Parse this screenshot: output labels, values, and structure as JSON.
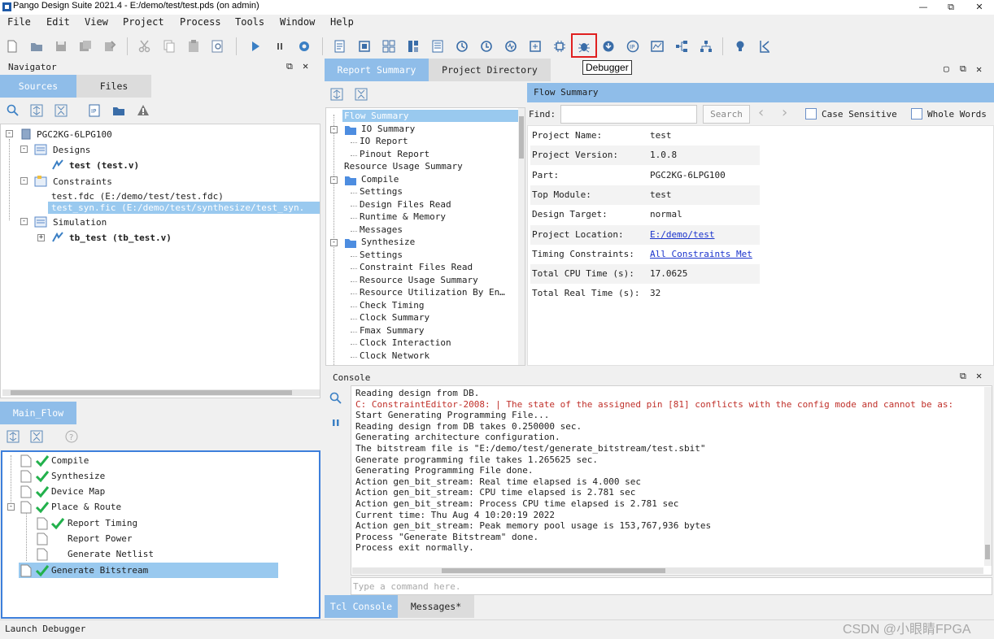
{
  "window": {
    "title": "Pango Design Suite 2021.4 - E:/demo/test/test.pds (on admin)",
    "controls": [
      "—",
      "⧉",
      "✕"
    ]
  },
  "menu": [
    "File",
    "Edit",
    "View",
    "Project",
    "Process",
    "Tools",
    "Window",
    "Help"
  ],
  "toolbar": {
    "tooltip": "Debugger",
    "icons": [
      "new-file-icon",
      "open-folder-icon",
      "save-icon",
      "save-all-icon",
      "save-as-icon",
      "cut-icon",
      "copy-icon",
      "paste-icon",
      "find-icon",
      "run-icon",
      "pause-icon",
      "settings-icon",
      "report-icon",
      "schematic-icon",
      "netlist-icon",
      "device-icon",
      "floorplan-icon",
      "timing-icon",
      "power-icon",
      "clock-icon",
      "io-icon",
      "chip-icon",
      "debugger-icon",
      "program-icon",
      "ip-icon",
      "waveform-icon",
      "hierarchy-icon",
      "tree-icon",
      "bulb-icon",
      "k-icon"
    ]
  },
  "navigator": {
    "title": "Navigator",
    "tabs": [
      "Sources",
      "Files"
    ],
    "device": "PGC2KG-6LPG100",
    "designs_label": "Designs",
    "design_file": "test (test.v)",
    "constraints_label": "Constraints",
    "constraint_files": [
      "test.fdc (E:/demo/test/test.fdc)",
      "test_syn.fic (E:/demo/test/synthesize/test_syn."
    ],
    "simulation_label": "Simulation",
    "sim_file": "tb_test (tb_test.v)"
  },
  "flow": {
    "tab": "Main_Flow",
    "steps": [
      "Compile",
      "Synthesize",
      "Device Map",
      "Place & Route",
      "Report Timing",
      "Report Power",
      "Generate Netlist",
      "Generate Bitstream"
    ]
  },
  "report": {
    "tabs": [
      "Report Summary",
      "Project Directory"
    ],
    "tree": [
      {
        "label": "Flow Summary",
        "level": 0,
        "selected": true
      },
      {
        "label": "IO Summary",
        "level": 0,
        "folder": true
      },
      {
        "label": "IO Report",
        "level": 1
      },
      {
        "label": "Pinout Report",
        "level": 1
      },
      {
        "label": "Resource Usage Summary",
        "level": 0
      },
      {
        "label": "Compile",
        "level": 0,
        "folder": true
      },
      {
        "label": "Settings",
        "level": 1
      },
      {
        "label": "Design Files Read",
        "level": 1
      },
      {
        "label": "Runtime & Memory",
        "level": 1
      },
      {
        "label": "Messages",
        "level": 1
      },
      {
        "label": "Synthesize",
        "level": 0,
        "folder": true
      },
      {
        "label": "Settings",
        "level": 1
      },
      {
        "label": "Constraint Files Read",
        "level": 1
      },
      {
        "label": "Resource Usage Summary",
        "level": 1
      },
      {
        "label": "Resource Utilization By En…",
        "level": 1
      },
      {
        "label": "Check Timing",
        "level": 1
      },
      {
        "label": "Clock Summary",
        "level": 1
      },
      {
        "label": "Fmax Summary",
        "level": 1
      },
      {
        "label": "Clock Interaction",
        "level": 1
      },
      {
        "label": "Clock Network",
        "level": 1
      }
    ],
    "summary_title": "Flow Summary",
    "find_label": "Find:",
    "search_button": "Search",
    "case_sensitive": "Case Sensitive",
    "whole_words": "Whole Words",
    "rows": [
      {
        "key": "Project Name:",
        "value": "test"
      },
      {
        "key": "Project Version:",
        "value": "1.0.8"
      },
      {
        "key": "Part:",
        "value": "PGC2KG-6LPG100"
      },
      {
        "key": "Top Module:",
        "value": "test"
      },
      {
        "key": "Design Target:",
        "value": "normal"
      },
      {
        "key": "Project Location:",
        "value": "E:/demo/test",
        "link": true
      },
      {
        "key": "Timing Constraints:",
        "value": "All Constraints Met",
        "link": true
      },
      {
        "key": "Total CPU Time (s):",
        "value": "17.0625"
      },
      {
        "key": "Total Real Time (s):",
        "value": "32"
      }
    ]
  },
  "console": {
    "title": "Console",
    "lines": [
      {
        "text": "Reading design from DB."
      },
      {
        "text": "C: ConstraintEditor-2008:  | The state of the assigned pin [81] conflicts with the config mode and cannot be as:",
        "error": true
      },
      {
        "text": "Start Generating Programming File..."
      },
      {
        "text": "Reading design from DB takes 0.250000 sec."
      },
      {
        "text": "Generating architecture configuration."
      },
      {
        "text": "The bitstream file is \"E:/demo/test/generate_bitstream/test.sbit\""
      },
      {
        "text": "Generate programming file takes 1.265625 sec."
      },
      {
        "text": "Generating Programming File done."
      },
      {
        "text": "Action gen_bit_stream: Real time elapsed is 4.000 sec"
      },
      {
        "text": "Action gen_bit_stream: CPU time elapsed is 2.781 sec"
      },
      {
        "text": "Action gen_bit_stream: Process CPU time elapsed is 2.781 sec"
      },
      {
        "text": "Current time: Thu Aug  4 10:20:19 2022"
      },
      {
        "text": "Action gen_bit_stream: Peak memory pool usage is 153,767,936 bytes"
      },
      {
        "text": "Process \"Generate Bitstream\" done."
      },
      {
        "text": "Process exit normally."
      }
    ],
    "input_placeholder": "Type a command here.",
    "tabs": [
      "Tcl Console",
      "Messages*"
    ]
  },
  "status": {
    "text": "Launch Debugger",
    "watermark": "CSDN @小眼睛FPGA"
  },
  "colors": {
    "accent": "#8fbde9",
    "selection": "#99c9ef",
    "check": "#22b14c",
    "error": "#c0302a",
    "link": "#1a33cc",
    "highlight_box": "#e02020"
  }
}
